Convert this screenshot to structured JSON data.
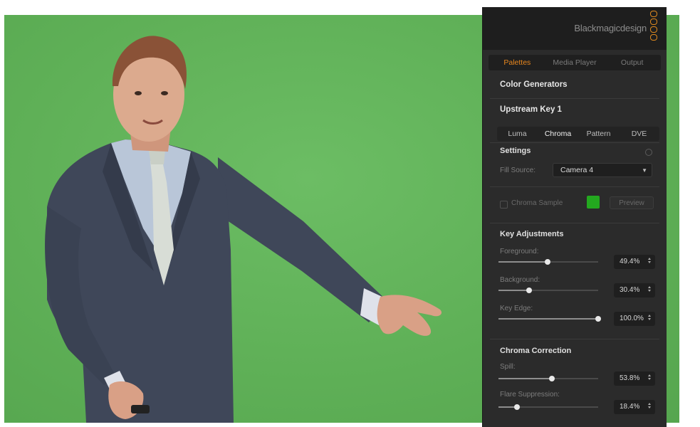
{
  "brand": {
    "name": "Blackmagicdesign",
    "logo_color": "#e08a1e"
  },
  "main_tabs": [
    {
      "label": "Palettes",
      "active": true
    },
    {
      "label": "Media Player",
      "active": false
    },
    {
      "label": "Output",
      "active": false
    }
  ],
  "color_generators_title": "Color Generators",
  "upstream_key_title": "Upstream Key 1",
  "key_tabs": [
    {
      "label": "Luma",
      "active": false
    },
    {
      "label": "Chroma",
      "active": true
    },
    {
      "label": "Pattern",
      "active": false
    },
    {
      "label": "DVE",
      "active": false
    }
  ],
  "settings": {
    "title": "Settings",
    "fill_source_label": "Fill Source:",
    "fill_source_value": "Camera 4",
    "chroma_sample_label": "Chroma Sample",
    "chroma_sample_color": "#23a81f",
    "preview_label": "Preview"
  },
  "key_adjustments": {
    "title": "Key Adjustments",
    "foreground": {
      "label": "Foreground:",
      "value_text": "49.4%",
      "level": 0.494
    },
    "background": {
      "label": "Background:",
      "value_text": "30.4%",
      "level": 0.304
    },
    "key_edge": {
      "label": "Key Edge:",
      "value_text": "100.0%",
      "level": 1.0
    }
  },
  "chroma_correction": {
    "title": "Chroma Correction",
    "spill": {
      "label": "Spill:",
      "value_text": "53.8%",
      "level": 0.538
    },
    "flare_suppression": {
      "label": "Flare Suppression:",
      "value_text": "18.4%",
      "level": 0.184
    }
  },
  "scene": {
    "background_color": "#5fb057"
  }
}
